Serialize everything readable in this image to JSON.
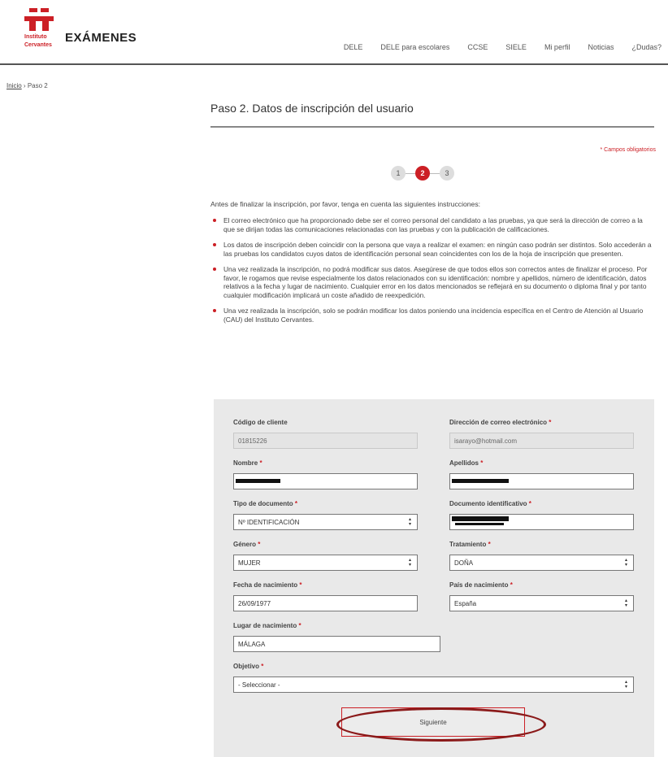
{
  "header": {
    "brand": "EXÁMENES",
    "logo_line1": "Instituto",
    "logo_line2": "Cervantes",
    "nav": [
      "DELE",
      "DELE para escolares",
      "CCSE",
      "SIELE",
      "Mi perfil",
      "Noticias",
      "¿Dudas?"
    ]
  },
  "breadcrumb": {
    "home": "Inicio",
    "separator": "›",
    "current": "Paso 2"
  },
  "page": {
    "title": "Paso 2. Datos de inscripción del usuario",
    "required_note": "* Campos obligatorios",
    "steps": [
      "1",
      "2",
      "3"
    ],
    "active_step": 2
  },
  "instructions": {
    "intro": "Antes de finalizar la inscripción, por favor, tenga en cuenta las siguientes instrucciones:",
    "items": [
      "El correo electrónico que ha proporcionado debe ser el correo personal del candidato a las pruebas, ya que será la dirección de correo a la que se dirijan todas las comunicaciones relacionadas con las pruebas y con la publicación de calificaciones.",
      "Los datos de inscripción deben coincidir con la persona que vaya a realizar el examen: en ningún caso podrán ser distintos. Solo accederán a las pruebas los candidatos cuyos datos de identificación personal sean coincidentes con los de la hoja de inscripción que presenten.",
      "Una vez realizada la inscripción, no podrá modificar sus datos. Asegúrese de que todos ellos son correctos antes de finalizar el proceso. Por favor, le rogamos que revise especialmente los datos relacionados con su identificación: nombre y apellidos, número de identificación, datos relativos a la fecha y lugar de nacimiento. Cualquier error en los datos mencionados se reflejará en su documento o diploma final y por tanto cualquier modificación implicará un coste añadido de reexpedición.",
      "Una vez realizada la inscripción, solo se podrán modificar los datos poniendo una incidencia específica en el Centro de Atención al Usuario (CAU) del Instituto Cervantes."
    ]
  },
  "form": {
    "client_code": {
      "label": "Código de cliente",
      "value": "01815226"
    },
    "email": {
      "label": "Dirección de correo electrónico",
      "value": "isarayo@hotmail.com"
    },
    "name": {
      "label": "Nombre",
      "value": ""
    },
    "surname": {
      "label": "Apellidos",
      "value": ""
    },
    "doc_type": {
      "label": "Tipo de documento",
      "value": "Nº IDENTIFICACIÓN"
    },
    "doc_id": {
      "label": "Documento identificativo",
      "value": ""
    },
    "gender": {
      "label": "Género",
      "value": "MUJER"
    },
    "title": {
      "label": "Tratamiento",
      "value": "DOÑA"
    },
    "birth_date": {
      "label": "Fecha de nacimiento",
      "value": "26/09/1977"
    },
    "birth_country": {
      "label": "País de nacimiento",
      "value": "España"
    },
    "birth_place": {
      "label": "Lugar de nacimiento",
      "value": "MÁLAGA"
    },
    "objective": {
      "label": "Objetivo",
      "value": "- Seleccionar -"
    },
    "required_mark": "*",
    "next_button": "Siguiente"
  },
  "colors": {
    "accent": "#cc1f25",
    "panel": "#e9e9e9",
    "annotation": "#8b1a1a"
  }
}
